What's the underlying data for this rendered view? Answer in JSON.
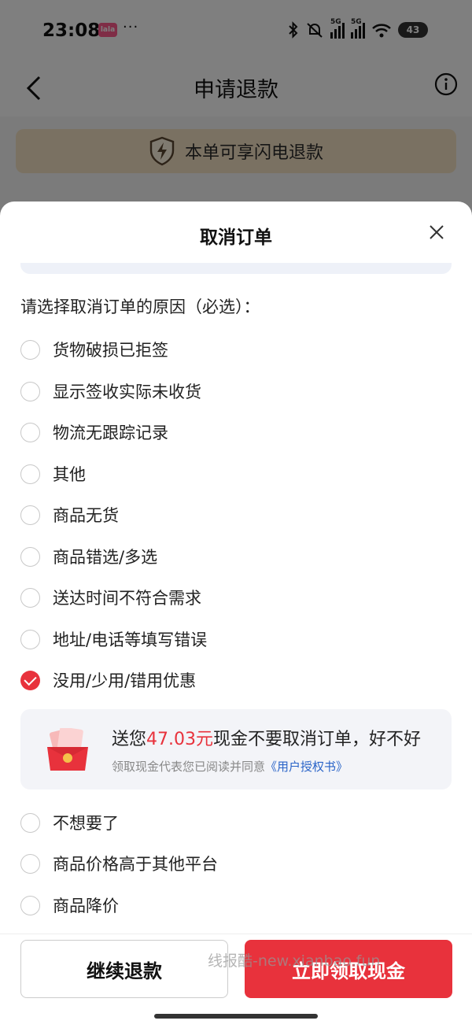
{
  "status_bar": {
    "time": "23:08",
    "app_badge": "lala",
    "dots": "···",
    "battery": "43",
    "signal_tag": "5G"
  },
  "header": {
    "title": "申请退款"
  },
  "flash_banner": {
    "text": "本单可享闪电退款"
  },
  "sheet": {
    "title": "取消订单",
    "prompt": "请选择取消订单的原因（必选）：",
    "reasons_top": [
      {
        "label": "货物破损已拒签",
        "checked": false
      },
      {
        "label": "显示签收实际未收货",
        "checked": false
      },
      {
        "label": "物流无跟踪记录",
        "checked": false
      },
      {
        "label": "其他",
        "checked": false
      },
      {
        "label": "商品无货",
        "checked": false
      },
      {
        "label": "商品错选/多选",
        "checked": false
      },
      {
        "label": "送达时间不符合需求",
        "checked": false
      },
      {
        "label": "地址/电话等填写错误",
        "checked": false
      },
      {
        "label": "没用/少用/错用优惠",
        "checked": true
      }
    ],
    "offer": {
      "prefix": "送您",
      "amount": "47.03元",
      "suffix": "现金不要取消订单，好不好",
      "consent_prefix": "领取现金代表您已阅读并同意",
      "consent_link": "《用户授权书》"
    },
    "reasons_bottom": [
      {
        "label": "不想要了",
        "checked": false
      },
      {
        "label": "商品价格高于其他平台",
        "checked": false
      },
      {
        "label": "商品降价",
        "checked": false
      }
    ],
    "continue_button": "继续退款",
    "claim_button": "立即领取现金",
    "watermark": "线报酷-new.xianbao.fun"
  },
  "colors": {
    "accent": "#e8323c",
    "link": "#2a64c8",
    "banner": "#f5e2c4"
  }
}
